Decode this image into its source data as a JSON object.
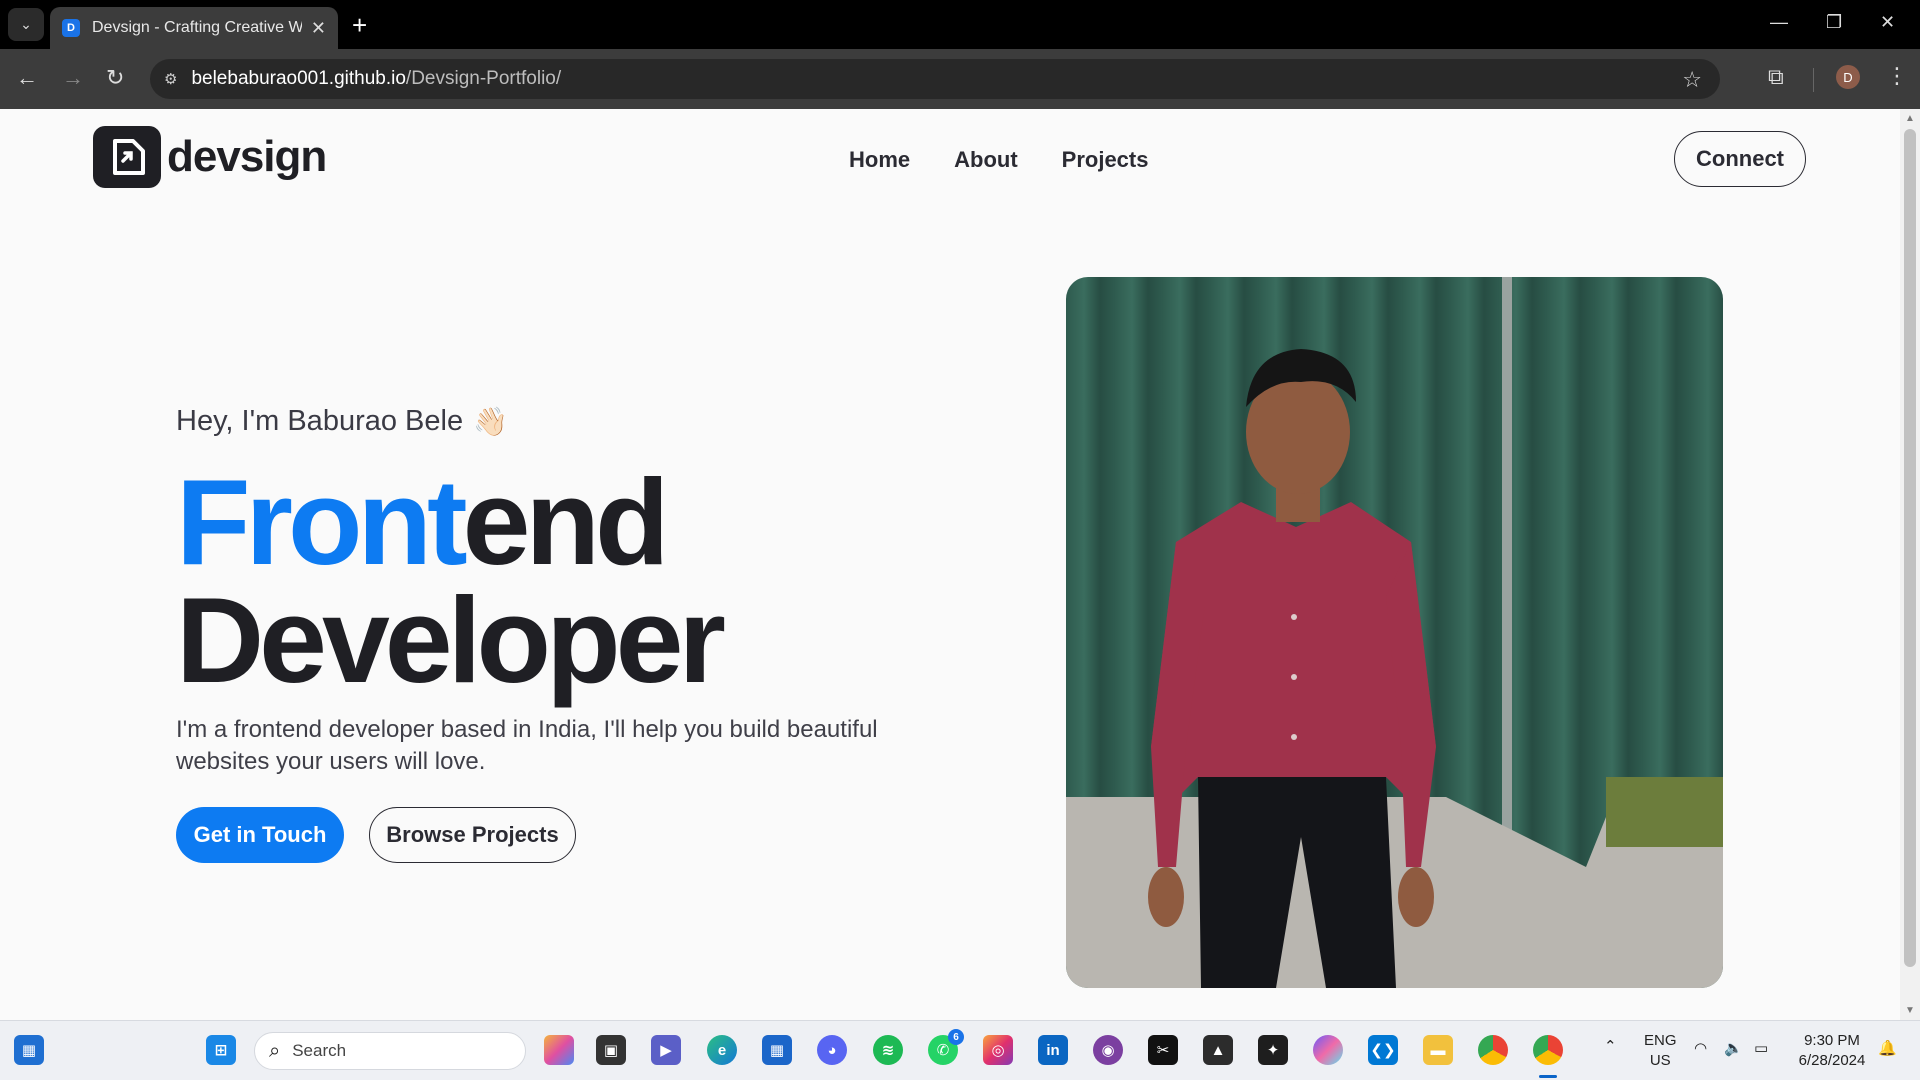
{
  "browser": {
    "tab_title": "Devsign - Crafting Creative Wel",
    "favicon_letter": "D",
    "url_host": "belebaburao001.github.io",
    "url_path": "/Devsign-Portfolio/",
    "profile_letter": "D"
  },
  "site": {
    "logo_text": "devsign",
    "nav": [
      "Home",
      "About",
      "Projects"
    ],
    "connect_label": "Connect",
    "greeting": "Hey, I'm Baburao Bele",
    "wave_emoji": "👋🏻",
    "headline_accent": "Front",
    "headline_rest": "end",
    "headline_line2": "Developer",
    "subtext": "I'm a frontend developer based in India, I'll help you build beautiful websites your users will love.",
    "primary_cta": "Get in Touch",
    "secondary_cta": "Browse Projects",
    "accent_color": "#0d7bf2",
    "dark_color": "#1f1f24"
  },
  "taskbar": {
    "search_placeholder": "Search",
    "whatsapp_badge": "6",
    "language": "ENG",
    "region": "US",
    "time": "9:30 PM",
    "date": "6/28/2024"
  }
}
